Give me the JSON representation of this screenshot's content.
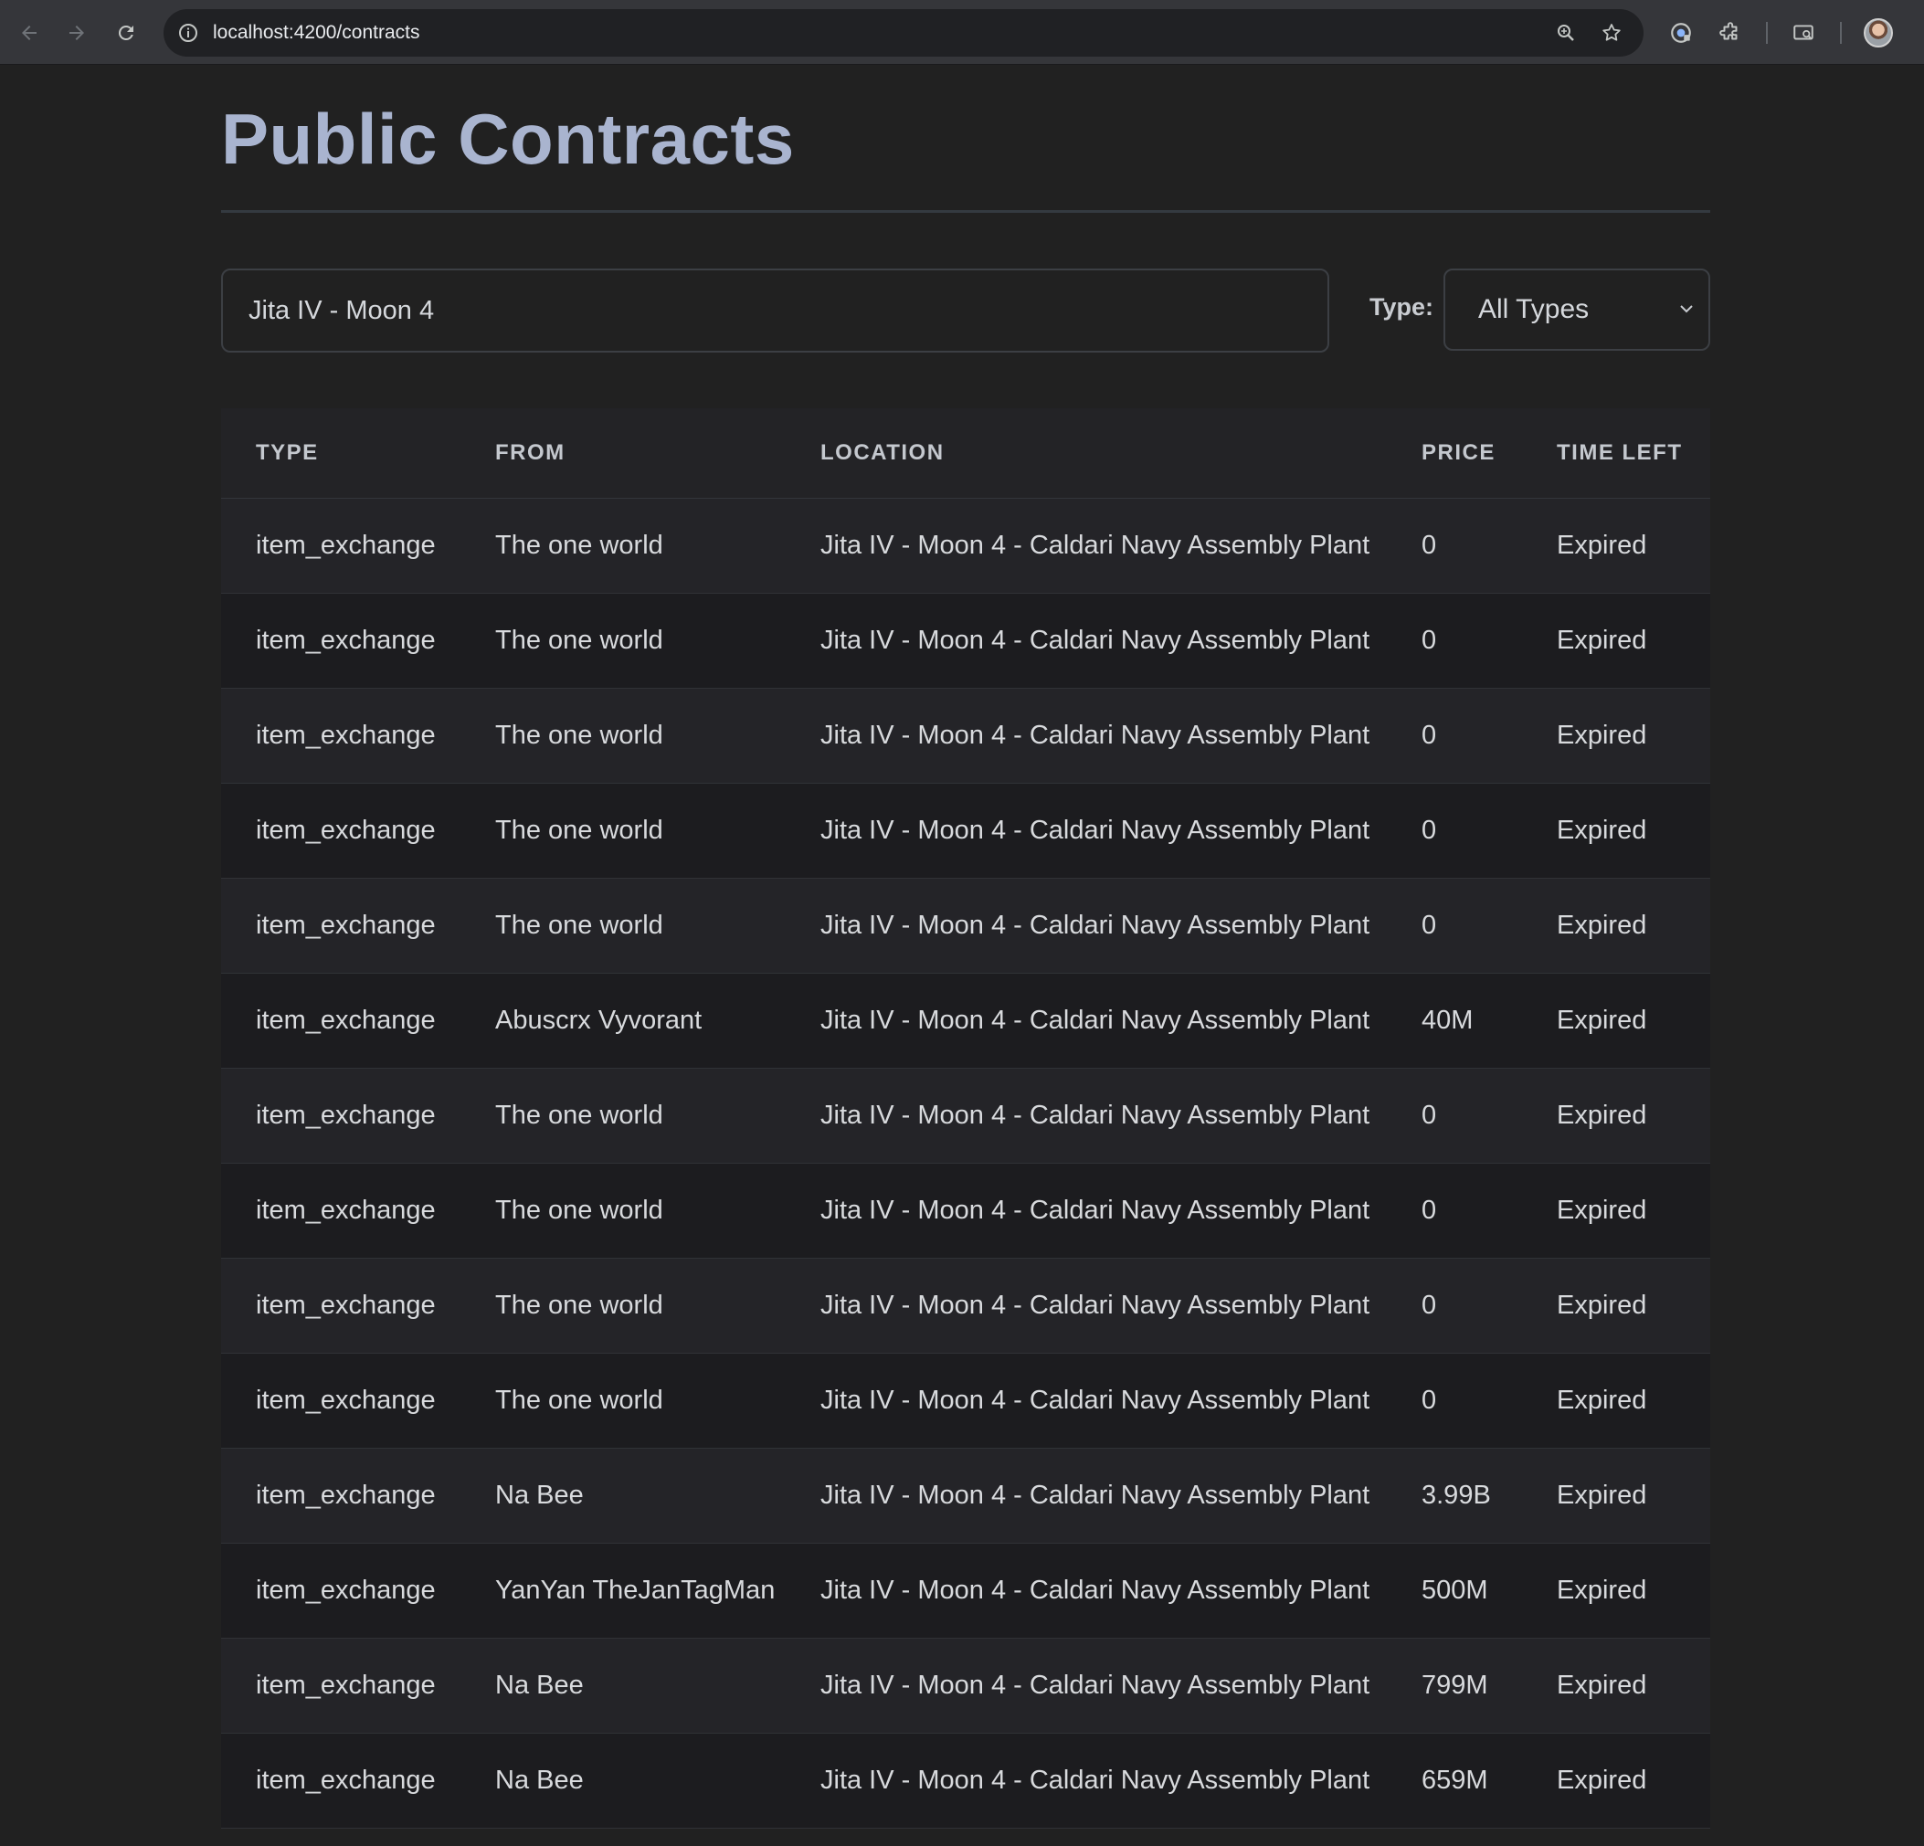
{
  "browser": {
    "url": "localhost:4200/contracts",
    "back_icon": "arrow-left-icon",
    "forward_icon": "arrow-right-icon",
    "reload_icon": "reload-icon"
  },
  "page": {
    "title": "Public Contracts"
  },
  "filters": {
    "search_value": "Jita IV - Moon 4",
    "type_label": "Type:",
    "type_selected": "All Types"
  },
  "table": {
    "headers": {
      "type": "TYPE",
      "from": "FROM",
      "location": "LOCATION",
      "price": "PRICE",
      "time_left": "TIME LEFT"
    },
    "rows": [
      {
        "type": "item_exchange",
        "from": "The one world",
        "location": "Jita IV - Moon 4 - Caldari Navy Assembly Plant",
        "price": "0",
        "time_left": "Expired"
      },
      {
        "type": "item_exchange",
        "from": "The one world",
        "location": "Jita IV - Moon 4 - Caldari Navy Assembly Plant",
        "price": "0",
        "time_left": "Expired"
      },
      {
        "type": "item_exchange",
        "from": "The one world",
        "location": "Jita IV - Moon 4 - Caldari Navy Assembly Plant",
        "price": "0",
        "time_left": "Expired"
      },
      {
        "type": "item_exchange",
        "from": "The one world",
        "location": "Jita IV - Moon 4 - Caldari Navy Assembly Plant",
        "price": "0",
        "time_left": "Expired"
      },
      {
        "type": "item_exchange",
        "from": "The one world",
        "location": "Jita IV - Moon 4 - Caldari Navy Assembly Plant",
        "price": "0",
        "time_left": "Expired"
      },
      {
        "type": "item_exchange",
        "from": "Abuscrx Vyvorant",
        "location": "Jita IV - Moon 4 - Caldari Navy Assembly Plant",
        "price": "40M",
        "time_left": "Expired"
      },
      {
        "type": "item_exchange",
        "from": "The one world",
        "location": "Jita IV - Moon 4 - Caldari Navy Assembly Plant",
        "price": "0",
        "time_left": "Expired"
      },
      {
        "type": "item_exchange",
        "from": "The one world",
        "location": "Jita IV - Moon 4 - Caldari Navy Assembly Plant",
        "price": "0",
        "time_left": "Expired"
      },
      {
        "type": "item_exchange",
        "from": "The one world",
        "location": "Jita IV - Moon 4 - Caldari Navy Assembly Plant",
        "price": "0",
        "time_left": "Expired"
      },
      {
        "type": "item_exchange",
        "from": "The one world",
        "location": "Jita IV - Moon 4 - Caldari Navy Assembly Plant",
        "price": "0",
        "time_left": "Expired"
      },
      {
        "type": "item_exchange",
        "from": "Na Bee",
        "location": "Jita IV - Moon 4 - Caldari Navy Assembly Plant",
        "price": "3.99B",
        "time_left": "Expired"
      },
      {
        "type": "item_exchange",
        "from": "YanYan TheJanTagMan",
        "location": "Jita IV - Moon 4 - Caldari Navy Assembly Plant",
        "price": "500M",
        "time_left": "Expired"
      },
      {
        "type": "item_exchange",
        "from": "Na Bee",
        "location": "Jita IV - Moon 4 - Caldari Navy Assembly Plant",
        "price": "799M",
        "time_left": "Expired"
      },
      {
        "type": "item_exchange",
        "from": "Na Bee",
        "location": "Jita IV - Moon 4 - Caldari Navy Assembly Plant",
        "price": "659M",
        "time_left": "Expired"
      }
    ]
  }
}
